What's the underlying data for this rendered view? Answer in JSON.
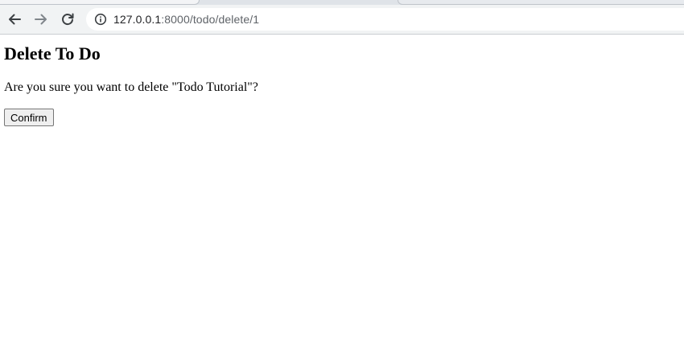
{
  "browser": {
    "url_host": "127.0.0.1",
    "url_path": ":8000/todo/delete/1",
    "icons": {
      "back": "arrow-left-icon",
      "forward": "arrow-right-icon",
      "reload": "reload-icon",
      "site_info": "info-icon"
    }
  },
  "page": {
    "title": "Delete To Do",
    "message": "Are you sure you want to delete \"Todo Tutorial\"?",
    "confirm_label": "Confirm"
  }
}
